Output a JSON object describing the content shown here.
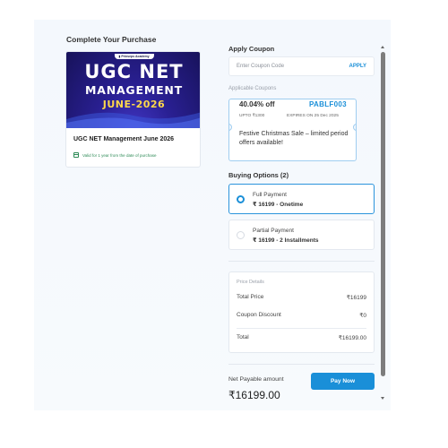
{
  "page": {
    "title": "Complete Your Purchase"
  },
  "course": {
    "banner_badge": "▮ Prinseps Academy",
    "banner_line1": "UGC NET",
    "banner_line2": "MANAGEMENT",
    "banner_line3": "JUNE-2026",
    "title": "UGC NET Management June 2026",
    "validity": "Valid for 1 year from the date of purchase"
  },
  "coupon": {
    "heading": "Apply Coupon",
    "placeholder": "Enter Coupon Code",
    "apply_label": "APPLY",
    "applicable_label": "Applicable Coupons",
    "card": {
      "discount": "40.04% off",
      "code": "PABLF003",
      "upto": "UPTO ₹1300",
      "expires": "EXPIRES ON 25 Dec 2025",
      "description": "Festive Christmas Sale – limited period offers available!"
    }
  },
  "buying_options": {
    "heading": "Buying Options (2)",
    "options": [
      {
        "name": "Full Payment",
        "price": "₹ 16199 - Onetime",
        "selected": true
      },
      {
        "name": "Partial Payment",
        "price": "₹ 16199 - 2 Installments",
        "selected": false
      }
    ]
  },
  "price_details": {
    "label": "Price Details",
    "rows": [
      {
        "label": "Total Price",
        "value": "₹16199"
      },
      {
        "label": "Coupon Discount",
        "value": "₹0"
      },
      {
        "label": "Total",
        "value": "₹16199.00"
      }
    ]
  },
  "checkout": {
    "net_label": "Net Payable amount",
    "net_value": "₹16199.00",
    "pay_label": "Pay Now"
  },
  "colors": {
    "accent": "#1a8fd8",
    "success": "#2e8b57",
    "banner": "#2a2094",
    "banner_accent": "#ffd84a"
  }
}
